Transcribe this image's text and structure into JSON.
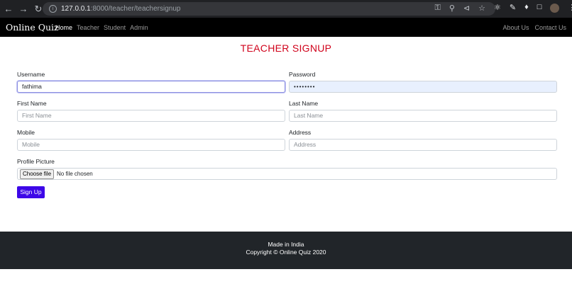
{
  "browser": {
    "url_host": "127.0.0.1",
    "url_path": ":8000/teacher/teachersignup"
  },
  "navbar": {
    "brand": "Online Quiz",
    "links": [
      "Home",
      "Teacher",
      "Student",
      "Admin"
    ],
    "active_link": "Home",
    "right_links": [
      "About Us",
      "Contact Us"
    ]
  },
  "form": {
    "title": "TEACHER SIGNUP",
    "username_label": "Username",
    "username_value": "fathima",
    "password_label": "Password",
    "password_value": "••••••••",
    "first_name_label": "First Name",
    "first_name_placeholder": "First Name",
    "last_name_label": "Last Name",
    "last_name_placeholder": "Last Name",
    "mobile_label": "Mobile",
    "mobile_placeholder": "Mobile",
    "address_label": "Address",
    "address_placeholder": "Address",
    "profile_label": "Profile Picture",
    "choose_file_label": "Choose file",
    "no_file_text": "No file chosen",
    "submit_label": "Sign Up",
    "title_color": "#d0021b",
    "button_color": "#3d07e8"
  },
  "footer": {
    "line1": "Made in India",
    "line2": "Copyright © Online Quiz 2020"
  }
}
